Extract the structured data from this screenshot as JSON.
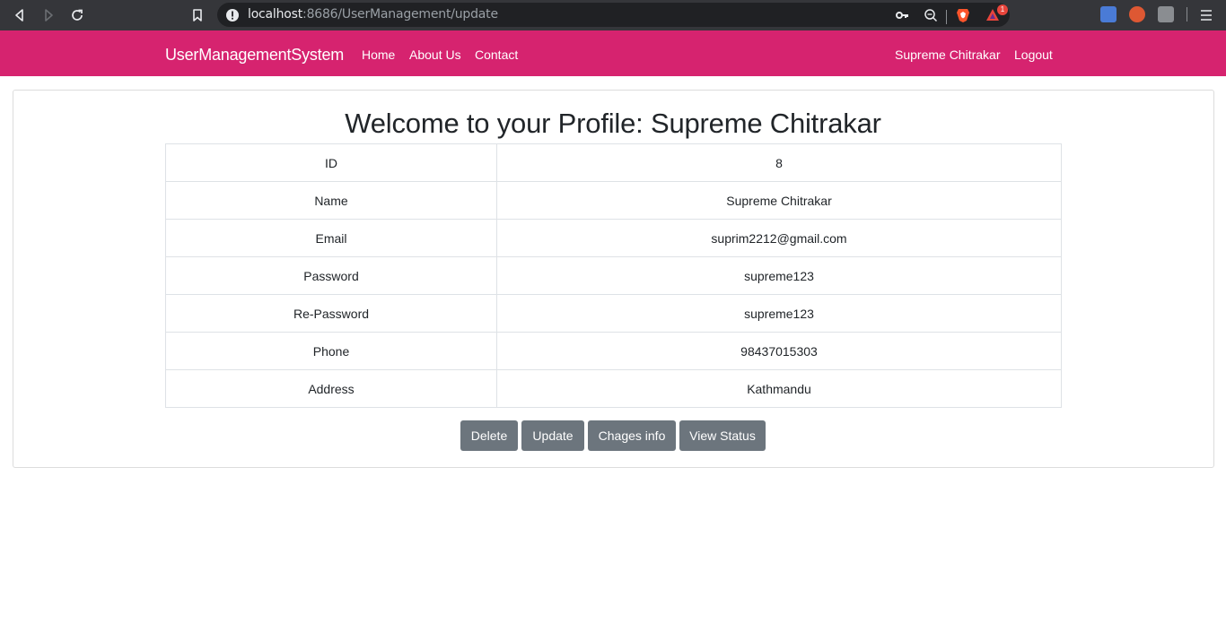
{
  "browser": {
    "url_host": "localhost",
    "url_path": ":8686/UserManagement/update",
    "notification_count": "1"
  },
  "navbar": {
    "brand": "UserManagementSystem",
    "links": [
      "Home",
      "About Us",
      "Contact"
    ],
    "user": "Supreme Chitrakar",
    "logout": "Logout",
    "color": "#d6236f"
  },
  "profile": {
    "title": "Welcome to your Profile: Supreme Chitrakar",
    "rows": [
      {
        "label": "ID",
        "value": "8"
      },
      {
        "label": "Name",
        "value": "Supreme Chitrakar"
      },
      {
        "label": "Email",
        "value": "suprim2212@gmail.com"
      },
      {
        "label": "Password",
        "value": "supreme123"
      },
      {
        "label": "Re-Password",
        "value": "supreme123"
      },
      {
        "label": "Phone",
        "value": "98437015303"
      },
      {
        "label": "Address",
        "value": "Kathmandu"
      }
    ]
  },
  "actions": {
    "delete": "Delete",
    "update": "Update",
    "changes_info": "Chages info",
    "view_status": "View Status",
    "button_color": "#6c757d"
  },
  "icons": [
    "back-icon",
    "forward-icon",
    "reload-icon",
    "bookmark-icon",
    "info-icon",
    "key-icon",
    "zoom-icon",
    "brave-shield-icon",
    "brave-rewards-icon",
    "translate-extension-icon",
    "duckduckgo-extension-icon",
    "extensions-icon",
    "menu-icon"
  ]
}
